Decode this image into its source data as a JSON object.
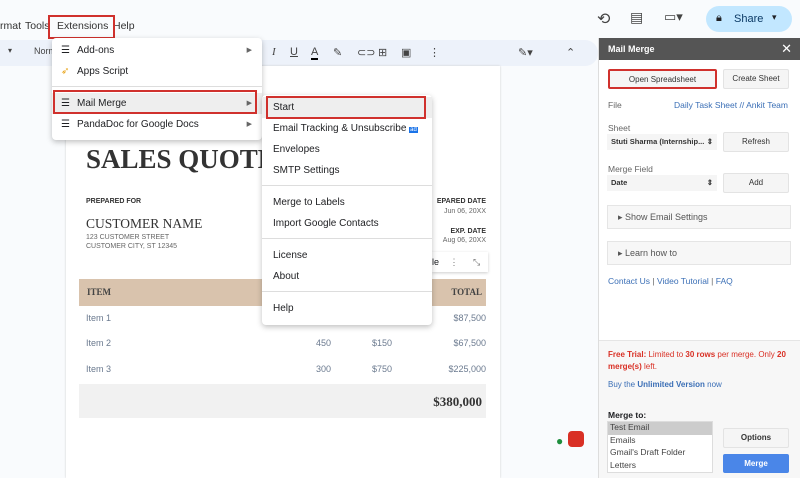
{
  "menubar": {
    "items": [
      "rmat",
      "Tools",
      "Extensions",
      "Help"
    ]
  },
  "toolbar": {
    "style": "Norm",
    "mode_caret": "▾"
  },
  "header_actions": {
    "share_label": "Share"
  },
  "extensions_menu": {
    "items": [
      {
        "label": "Add-ons",
        "icon": "addon-icon",
        "submenu": true
      },
      {
        "label": "Apps Script",
        "icon": "apps-script-icon",
        "submenu": false
      },
      {
        "label": "Mail Merge",
        "icon": "addon-icon",
        "submenu": true
      },
      {
        "label": "PandaDoc for Google Docs",
        "icon": "addon-icon",
        "submenu": true
      }
    ]
  },
  "mail_merge_submenu": {
    "items": [
      "Start",
      "Email Tracking & Unsubscribe",
      "Envelopes",
      "SMTP Settings",
      "Merge to Labels",
      "Import Google Contacts",
      "License",
      "About",
      "Help"
    ],
    "new_badge": "ad"
  },
  "document": {
    "title": "SALES QUOTE",
    "prepared_for_label": "PREPARED FOR",
    "customer_name": "CUSTOMER NAME",
    "street": "123 CUSTOMER STREET",
    "city": "CUSTOMER CITY, ST 12345",
    "prepared_date_label": "EPARED DATE",
    "prepared_date": "Jun 06, 20XX",
    "exp_date_label": "EXP. DATE",
    "exp_date": "Aug 06, 20XX",
    "floating_toolbar_text": "le",
    "table": {
      "headers": [
        "ITEM",
        "TOTAL"
      ],
      "rows": [
        {
          "item": "Item 1",
          "qty": "",
          "price": "",
          "total": "$87,500"
        },
        {
          "item": "Item 2",
          "qty": "450",
          "price": "$150",
          "total": "$67,500"
        },
        {
          "item": "Item 3",
          "qty": "300",
          "price": "$750",
          "total": "$225,000"
        }
      ],
      "grand_total": "$380,000"
    }
  },
  "sidebar": {
    "title": "Mail Merge",
    "open_spreadsheet": "Open Spreadsheet",
    "create_sheet": "Create Sheet",
    "file_label": "File",
    "file_link": "Daily Task Sheet // Ankit Team",
    "sheet_label": "Sheet",
    "sheet_value": "Stuti Sharma (Internship...",
    "refresh": "Refresh",
    "merge_field_label": "Merge Field",
    "merge_field_value": "Date",
    "add": "Add",
    "show_email_settings": "▸ Show Email Settings",
    "learn_how": "▸ Learn how to",
    "contact_us": "Contact Us",
    "video_tutorial": "Video Tutorial",
    "faq": "FAQ",
    "sep": " | ",
    "trial_label": "Free Trial:",
    "trial_text1": " Limited to ",
    "trial_rows": "30 rows",
    "trial_text2": " per merge. Only ",
    "trial_merges": "20 merge(s)",
    "trial_text3": " left.",
    "buy_text1": "Buy the ",
    "buy_link": "Unlimited Version",
    "buy_text2": " now",
    "merge_to_label": "Merge to:",
    "merge_to_options": [
      "Test Email",
      "Emails",
      "Gmail's Draft Folder",
      "Letters"
    ],
    "options": "Options",
    "merge": "Merge"
  },
  "colors": {
    "accent_red": "#d0312d",
    "merge_blue": "#4a86e8",
    "table_header": "#d9c3ad"
  }
}
